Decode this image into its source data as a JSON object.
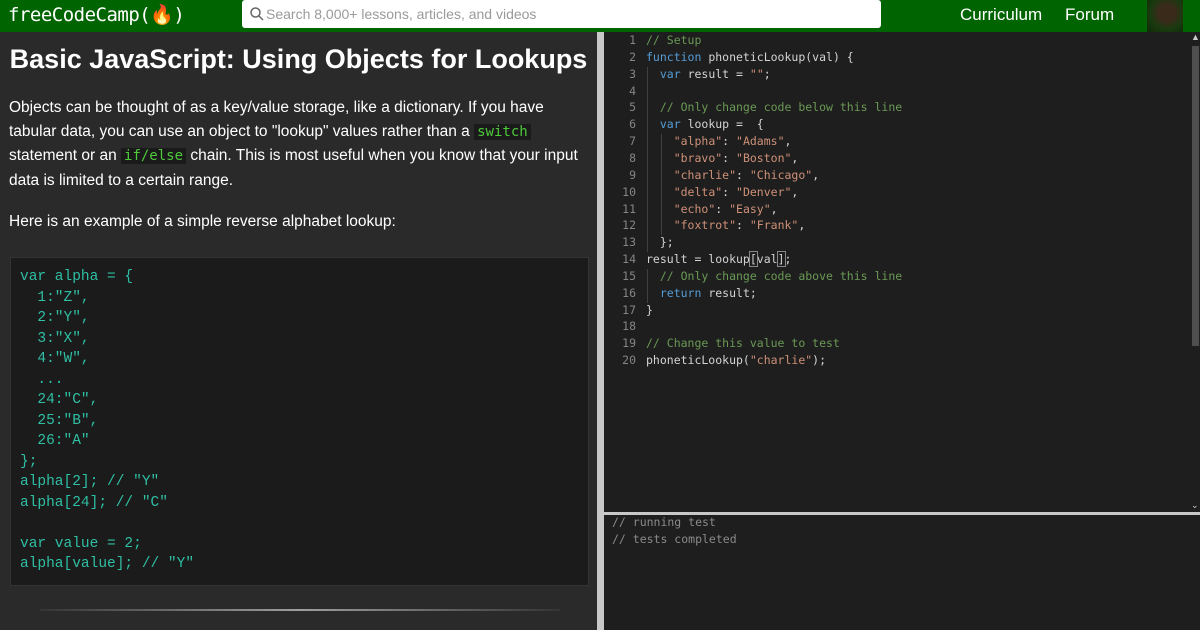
{
  "nav": {
    "logo": "freeCodeCamp(🔥)",
    "search_placeholder": "Search 8,000+ lessons, articles, and videos",
    "links": [
      "Curriculum",
      "Forum"
    ]
  },
  "lesson": {
    "title": "Basic JavaScript: Using Objects for Lookups",
    "p1_a": "Objects can be thought of as a key/value storage, like a dictionary. If you have tabular data, you can use an object to \"lookup\" values rather than a ",
    "p1_code1": "switch",
    "p1_b": " statement or an ",
    "p1_code2": "if/else",
    "p1_c": " chain. This is most useful when you know that your input data is limited to a certain range.",
    "p2": "Here is an example of a simple reverse alphabet lookup:",
    "example_code": "var alpha = {\n  1:\"Z\",\n  2:\"Y\",\n  3:\"X\",\n  4:\"W\",\n  ...\n  24:\"C\",\n  25:\"B\",\n  26:\"A\"\n};\nalpha[2]; // \"Y\"\nalpha[24]; // \"C\"\n\nvar value = 2;\nalpha[value]; // \"Y\""
  },
  "editor": {
    "line_numbers": [
      "1",
      "2",
      "3",
      "4",
      "5",
      "6",
      "7",
      "8",
      "9",
      "10",
      "11",
      "12",
      "13",
      "14",
      "15",
      "16",
      "17",
      "18",
      "19",
      "20"
    ],
    "lines": [
      [
        {
          "t": "// Setup",
          "c": "c-com"
        }
      ],
      [
        {
          "t": "function",
          "c": "c-kw"
        },
        {
          "t": " phoneticLookup(val) {",
          "c": "c-pl"
        }
      ],
      [
        {
          "t": "  ",
          "c": "c-pl"
        },
        {
          "t": "var",
          "c": "c-kw"
        },
        {
          "t": " result = ",
          "c": "c-pl"
        },
        {
          "t": "\"\"",
          "c": "c-str"
        },
        {
          "t": ";",
          "c": "c-pl"
        }
      ],
      [],
      [
        {
          "t": "  // Only change code below this line",
          "c": "c-com"
        }
      ],
      [
        {
          "t": "  ",
          "c": "c-pl"
        },
        {
          "t": "var",
          "c": "c-kw"
        },
        {
          "t": " lookup =  {",
          "c": "c-pl"
        }
      ],
      [
        {
          "t": "    ",
          "c": "c-pl"
        },
        {
          "t": "\"alpha\"",
          "c": "c-str"
        },
        {
          "t": ": ",
          "c": "c-pl"
        },
        {
          "t": "\"Adams\"",
          "c": "c-str"
        },
        {
          "t": ",",
          "c": "c-pl"
        }
      ],
      [
        {
          "t": "    ",
          "c": "c-pl"
        },
        {
          "t": "\"bravo\"",
          "c": "c-str"
        },
        {
          "t": ": ",
          "c": "c-pl"
        },
        {
          "t": "\"Boston\"",
          "c": "c-str"
        },
        {
          "t": ",",
          "c": "c-pl"
        }
      ],
      [
        {
          "t": "    ",
          "c": "c-pl"
        },
        {
          "t": "\"charlie\"",
          "c": "c-str"
        },
        {
          "t": ": ",
          "c": "c-pl"
        },
        {
          "t": "\"Chicago\"",
          "c": "c-str"
        },
        {
          "t": ",",
          "c": "c-pl"
        }
      ],
      [
        {
          "t": "    ",
          "c": "c-pl"
        },
        {
          "t": "\"delta\"",
          "c": "c-str"
        },
        {
          "t": ": ",
          "c": "c-pl"
        },
        {
          "t": "\"Denver\"",
          "c": "c-str"
        },
        {
          "t": ",",
          "c": "c-pl"
        }
      ],
      [
        {
          "t": "    ",
          "c": "c-pl"
        },
        {
          "t": "\"echo\"",
          "c": "c-str"
        },
        {
          "t": ": ",
          "c": "c-pl"
        },
        {
          "t": "\"Easy\"",
          "c": "c-str"
        },
        {
          "t": ",",
          "c": "c-pl"
        }
      ],
      [
        {
          "t": "    ",
          "c": "c-pl"
        },
        {
          "t": "\"foxtrot\"",
          "c": "c-str"
        },
        {
          "t": ": ",
          "c": "c-pl"
        },
        {
          "t": "\"Frank\"",
          "c": "c-str"
        },
        {
          "t": ",",
          "c": "c-pl"
        }
      ],
      [
        {
          "t": "  };",
          "c": "c-pl"
        }
      ],
      [
        {
          "t": "result = lookup",
          "c": "c-pl"
        },
        {
          "t": "[",
          "c": "c-pl bracket"
        },
        {
          "t": "val",
          "c": "c-pl"
        },
        {
          "t": "]",
          "c": "c-pl bracket"
        },
        {
          "t": ";",
          "c": "c-pl"
        }
      ],
      [
        {
          "t": "  // Only change code above this line",
          "c": "c-com"
        }
      ],
      [
        {
          "t": "  ",
          "c": "c-pl"
        },
        {
          "t": "return",
          "c": "c-kw"
        },
        {
          "t": " result;",
          "c": "c-pl"
        }
      ],
      [
        {
          "t": "}",
          "c": "c-pl"
        }
      ],
      [],
      [
        {
          "t": "// Change this value to test",
          "c": "c-com"
        }
      ],
      [
        {
          "t": "phoneticLookup(",
          "c": "c-pl"
        },
        {
          "t": "\"charlie\"",
          "c": "c-str"
        },
        {
          "t": ");",
          "c": "c-pl"
        }
      ]
    ]
  },
  "output": {
    "lines": [
      "// running test",
      "// tests completed"
    ]
  },
  "colors": {
    "nav_bg": "#006400",
    "inline_code": "#4ec93a",
    "example_code": "#2fbfa4",
    "comment": "#6a9955",
    "keyword": "#569cd6",
    "string": "#ce9178"
  },
  "icons": {
    "search": "search-icon",
    "avatar": "user-avatar",
    "scroll_up": "chevron-up-icon",
    "scroll_down": "chevron-down-icon"
  }
}
